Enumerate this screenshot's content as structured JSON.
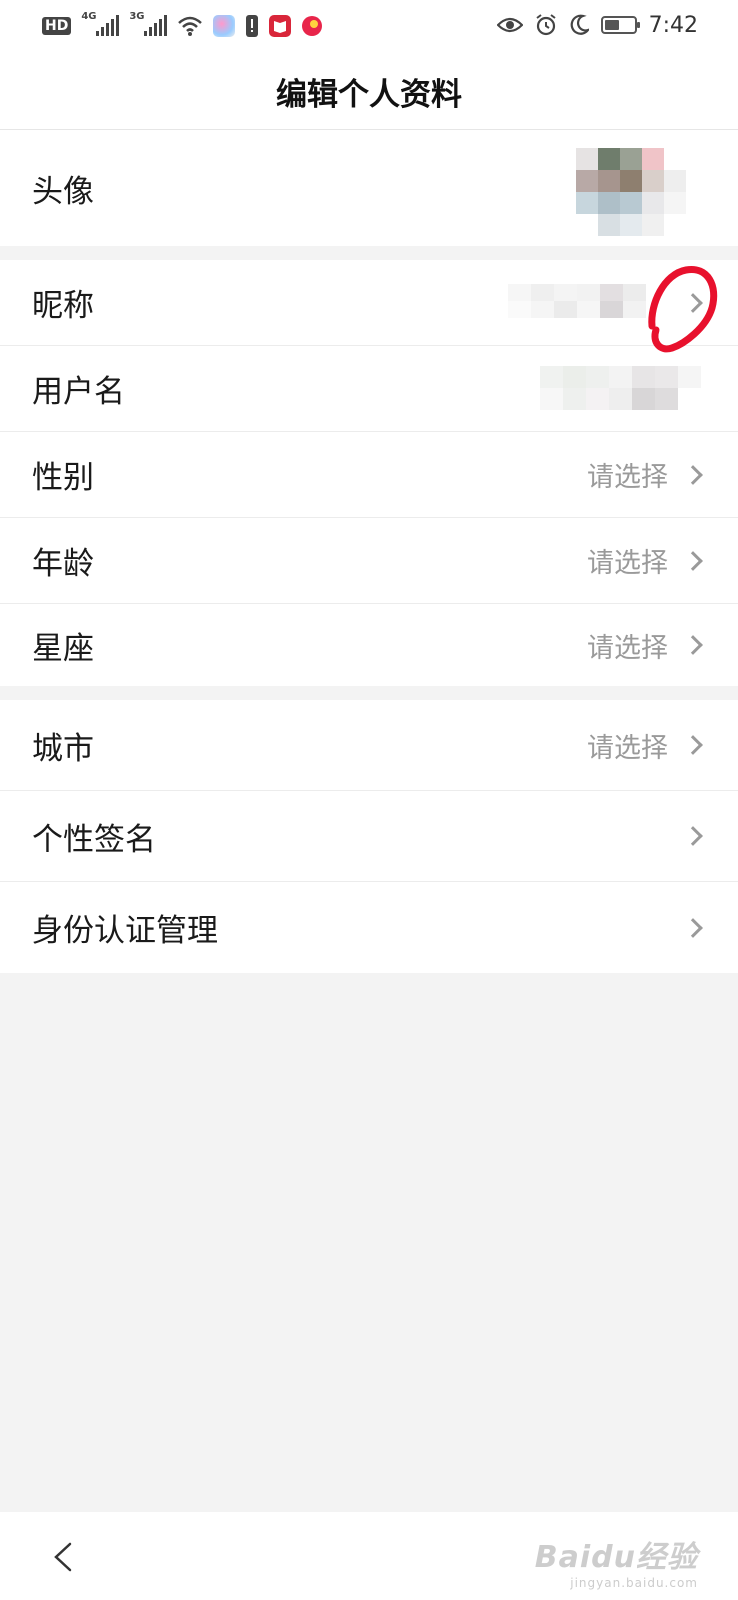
{
  "status_bar": {
    "hd": "HD",
    "net1": "4G",
    "net2": "3G",
    "time": "7:42",
    "icons": [
      "hd-icon",
      "signal-4g-icon",
      "signal-3g-icon",
      "wifi-icon",
      "app-icon",
      "warning-icon",
      "reader-app-icon",
      "video-app-icon",
      "eye-icon",
      "alarm-icon",
      "moon-icon",
      "battery-icon"
    ]
  },
  "header": {
    "title": "编辑个人资料"
  },
  "profile": {
    "avatar_label": "头像",
    "nickname_label": "昵称",
    "username_label": "用户名",
    "gender_label": "性别",
    "gender_value": "请选择",
    "age_label": "年龄",
    "age_value": "请选择",
    "zodiac_label": "星座",
    "zodiac_value": "请选择",
    "city_label": "城市",
    "city_value": "请选择",
    "signature_label": "个性签名",
    "identity_label": "身份认证管理"
  },
  "nav": {
    "back_icon": "back-arrow-icon"
  },
  "watermark": {
    "brand": "Baidu经验",
    "url": "jingyan.baidu.com"
  },
  "colors": {
    "background": "#f3f3f3",
    "row_bg": "#ffffff",
    "value_text": "#9a9a9a",
    "annotation": "#e8112d"
  }
}
